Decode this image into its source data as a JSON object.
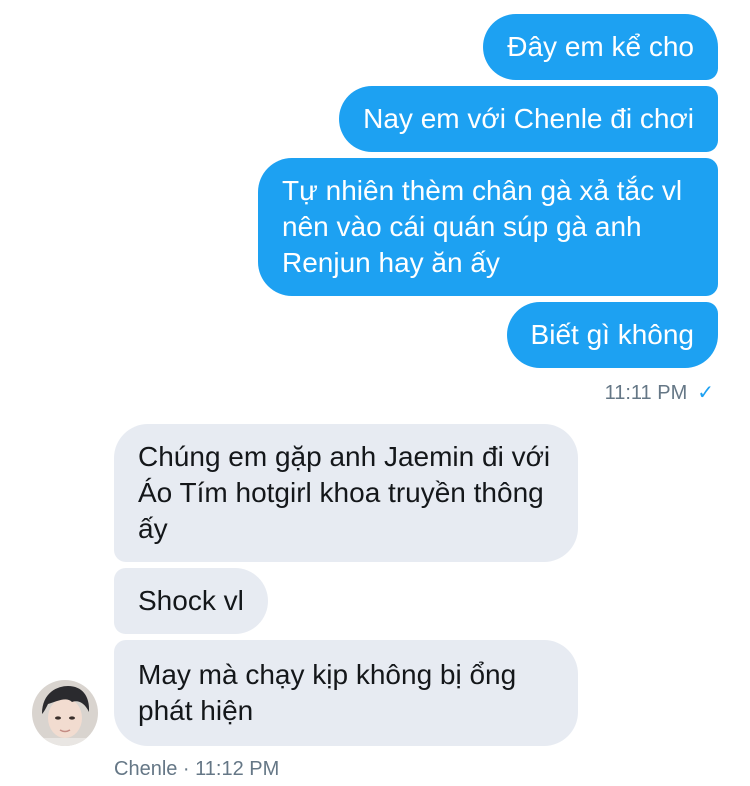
{
  "outgoing": {
    "messages": [
      "Đây em kể cho",
      "Nay em với Chenle đi chơi",
      "Tự nhiên thèm chân gà xả tắc vl nên vào cái quán súp gà anh Renjun hay ăn ấy",
      "Biết gì không"
    ],
    "timestamp": "11:11 PM",
    "status_icon": "checkmark-icon",
    "status_glyph": "✓"
  },
  "incoming": {
    "messages": [
      "Chúng em gặp anh Jaemin đi với Áo Tím hotgirl khoa truyền thông ấy",
      "Shock vl",
      "May mà chạy kịp không bị ổng phát hiện"
    ],
    "sender_meta": "Chenle · 11:12 PM",
    "avatar": "user-avatar-photo"
  },
  "colors": {
    "outgoing_bubble": "#1da1f2",
    "incoming_bubble": "#e7ebf2",
    "meta_text": "#657786"
  }
}
